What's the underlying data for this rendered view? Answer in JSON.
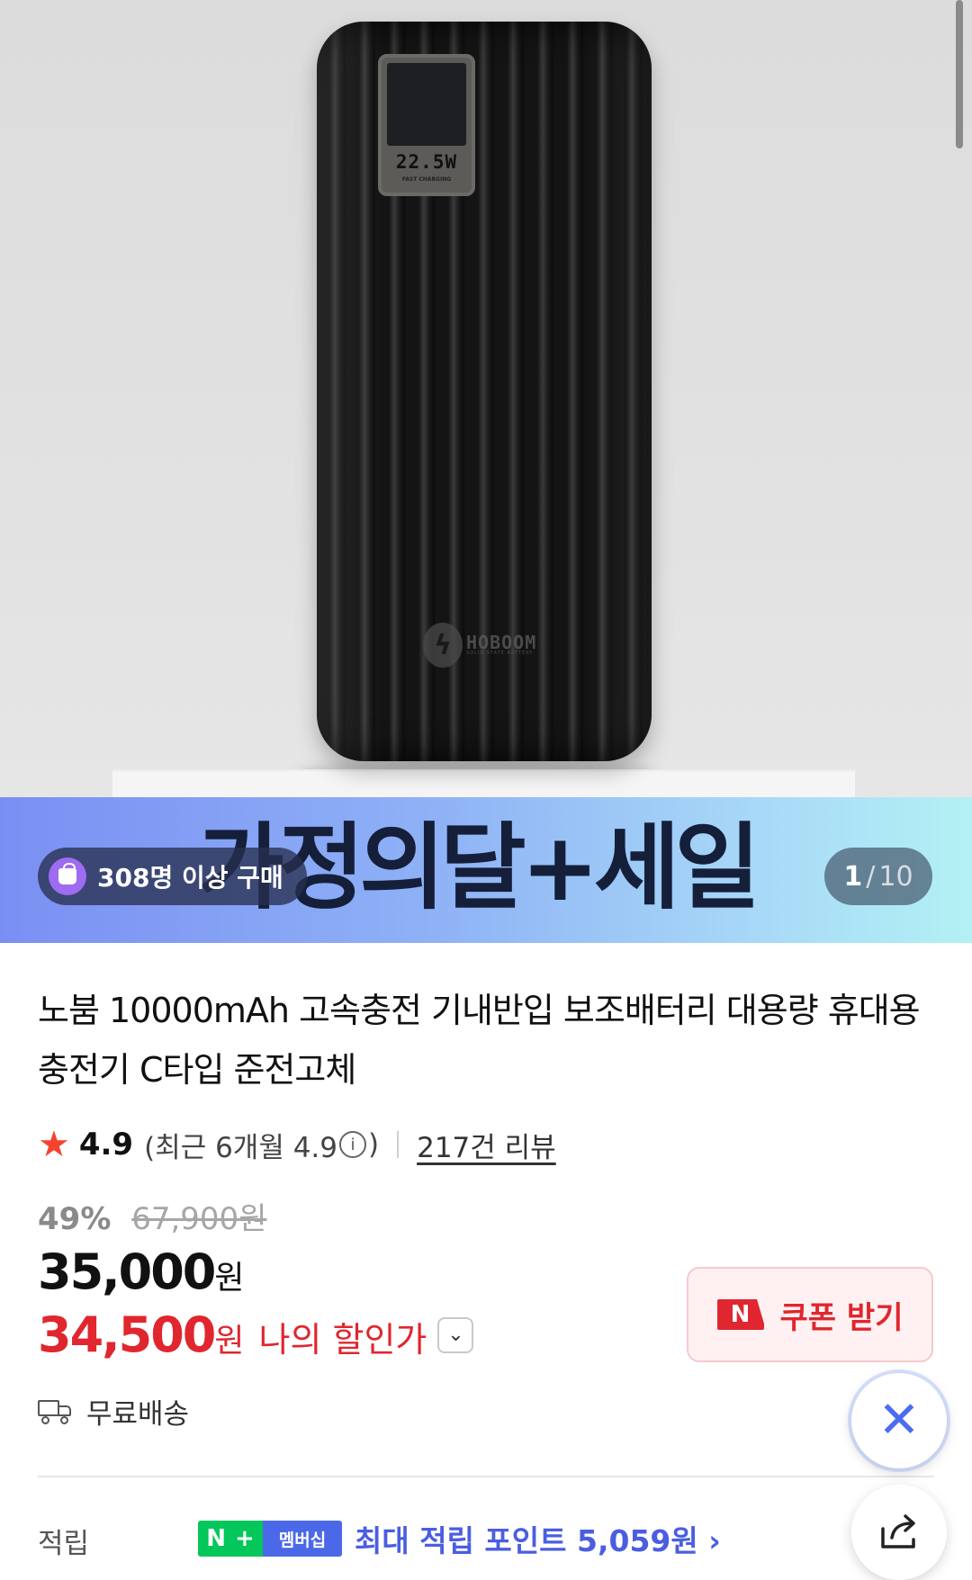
{
  "hero": {
    "product_display_text": "22.5W",
    "product_display_subtext": "FAST CHARGING",
    "product_brand_logo": "HOBOOM",
    "product_brand_tagline": "SOLID STATE BATTERY"
  },
  "promo": {
    "banner_text": "가정의달+세일",
    "buyers_badge": "308명 이상 구매",
    "gallery_current": "1",
    "gallery_separator": "/",
    "gallery_total": "10",
    "gradient_colors": [
      "#7a8ff3",
      "#a9dbf7",
      "#b3f1f4"
    ]
  },
  "product": {
    "title": "노붐 10000mAh 고속충전 기내반입 보조배터리 대용량 휴대용 충전기 C타입 준전고체",
    "rating": "4.9",
    "recent_rating_prefix": "(최근 6개월 4.9",
    "recent_rating_suffix": ")",
    "reviews_link": "217건 리뷰",
    "discount_rate": "49%",
    "original_price": "67,900원",
    "price": "35,000",
    "price_unit": "원",
    "my_price": "34,500",
    "my_price_unit": "원",
    "my_price_label": "나의 할인가",
    "coupon_button": "쿠폰 받기",
    "shipping": "무료배송",
    "points_label": "적립",
    "membership_badge": "멤버십",
    "points_text": "최대 적립 포인트 5,059원"
  },
  "icons": {
    "rating": "star-icon",
    "info": "info-icon",
    "chevron": "chevron-down-icon",
    "shipping": "truck-icon",
    "ai": "ai-assistant-icon",
    "share": "share-icon",
    "coupon_brand": "naver-n-icon"
  },
  "colors": {
    "accent_red": "#e0262e",
    "star": "#f5432f",
    "naver_green": "#03c75a",
    "membership_blue": "#4b68e8",
    "points_blue": "#4b5ee0"
  }
}
